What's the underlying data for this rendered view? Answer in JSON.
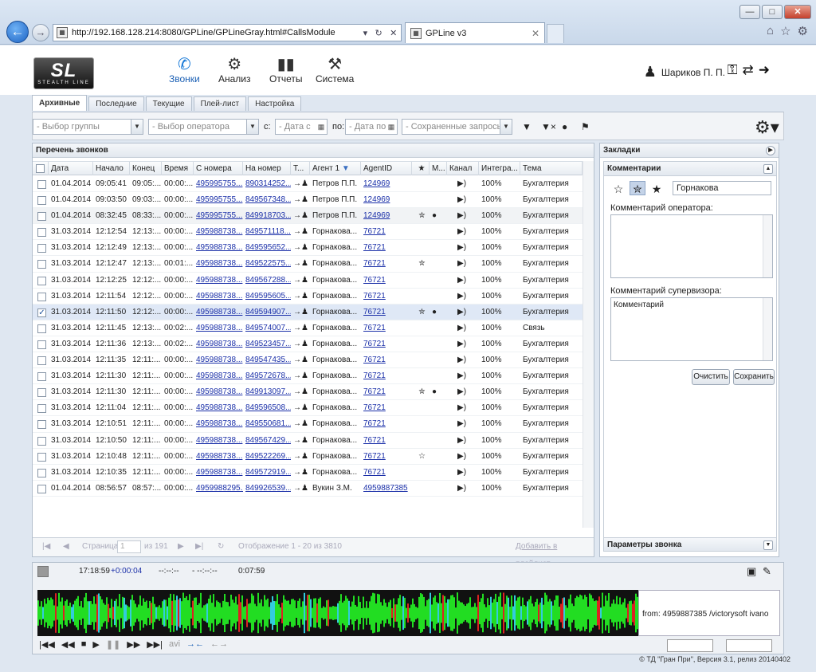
{
  "browser": {
    "url": "http://192.168.128.214:8080/GPLine/GPLineGray.html#CallsModule",
    "tab_title": "GPLine v3",
    "favicon": "page-icon",
    "window_buttons": [
      "minimize",
      "maximize",
      "close"
    ]
  },
  "app": {
    "logo_text": "SL",
    "logo_sub": "STEALTH LINE",
    "menu": [
      {
        "label": "Звонки",
        "icon": "phone-icon",
        "active": true
      },
      {
        "label": "Анализ",
        "icon": "gears-icon",
        "active": false
      },
      {
        "label": "Отчеты",
        "icon": "bar-chart-icon",
        "active": false
      },
      {
        "label": "Система",
        "icon": "tools-icon",
        "active": false
      }
    ],
    "user_name": "Шариков П. П."
  },
  "tabs": [
    "Архивные",
    "Последние",
    "Текущие",
    "Плей-лист",
    "Настройка"
  ],
  "filters": {
    "group": "- Выбор группы",
    "operator": "- Выбор оператора",
    "from_label": "с:",
    "date_from": "- Дата с",
    "to_label": "по:",
    "date_to": "- Дата по",
    "saved": "- Сохраненные запросы"
  },
  "calls": {
    "title": "Перечень звонков",
    "columns": [
      "Дата",
      "Начало",
      "Конец",
      "Время",
      "С номера",
      "На номер",
      "Т...",
      "Агент 1",
      "AgentID",
      "★",
      "М...",
      "Канал",
      "Интегра...",
      "Тема"
    ],
    "rows": [
      {
        "date": "01.04.2014",
        "start": "09:05:41",
        "end": "09:05:...",
        "dur": "00:00:...",
        "from": "495995755...",
        "to": "890314252...",
        "agent": "Петров П.П.",
        "agentid": "124969",
        "star": "",
        "m": "",
        "quality": "100%",
        "topic": "Бухгалтерия",
        "checked": false
      },
      {
        "date": "01.04.2014",
        "start": "09:03:50",
        "end": "09:03:...",
        "dur": "00:00:...",
        "from": "495995755...",
        "to": "849567348...",
        "agent": "Петров П.П.",
        "agentid": "124969",
        "star": "",
        "m": "",
        "quality": "100%",
        "topic": "Бухгалтерия",
        "checked": false
      },
      {
        "date": "01.04.2014",
        "start": "08:32:45",
        "end": "08:33:...",
        "dur": "00:00:...",
        "from": "495995755...",
        "to": "849918703...",
        "agent": "Петров П.П.",
        "agentid": "124969",
        "star": "half",
        "m": "yes",
        "quality": "100%",
        "topic": "Бухгалтерия",
        "checked": false
      },
      {
        "date": "31.03.2014",
        "start": "12:12:54",
        "end": "12:13:...",
        "dur": "00:00:...",
        "from": "495988738...",
        "to": "849571118...",
        "agent": "Горнакова...",
        "agentid": "76721",
        "star": "",
        "m": "",
        "quality": "100%",
        "topic": "Бухгалтерия",
        "checked": false
      },
      {
        "date": "31.03.2014",
        "start": "12:12:49",
        "end": "12:13:...",
        "dur": "00:00:...",
        "from": "495988738...",
        "to": "849595652...",
        "agent": "Горнакова...",
        "agentid": "76721",
        "star": "",
        "m": "",
        "quality": "100%",
        "topic": "Бухгалтерия",
        "checked": false
      },
      {
        "date": "31.03.2014",
        "start": "12:12:47",
        "end": "12:13:...",
        "dur": "00:01:...",
        "from": "495988738...",
        "to": "849522575...",
        "agent": "Горнакова...",
        "agentid": "76721",
        "star": "half",
        "m": "",
        "quality": "100%",
        "topic": "Бухгалтерия",
        "checked": false
      },
      {
        "date": "31.03.2014",
        "start": "12:12:25",
        "end": "12:12:...",
        "dur": "00:00:...",
        "from": "495988738...",
        "to": "849567288...",
        "agent": "Горнакова...",
        "agentid": "76721",
        "star": "",
        "m": "",
        "quality": "100%",
        "topic": "Бухгалтерия",
        "checked": false
      },
      {
        "date": "31.03.2014",
        "start": "12:11:54",
        "end": "12:12:...",
        "dur": "00:00:...",
        "from": "495988738...",
        "to": "849595605...",
        "agent": "Горнакова...",
        "agentid": "76721",
        "star": "",
        "m": "",
        "quality": "100%",
        "topic": "Бухгалтерия",
        "checked": false
      },
      {
        "date": "31.03.2014",
        "start": "12:11:50",
        "end": "12:12:...",
        "dur": "00:00:...",
        "from": "495988738...",
        "to": "849594907...",
        "agent": "Горнакова...",
        "agentid": "76721",
        "star": "half",
        "m": "yes",
        "quality": "100%",
        "topic": "Бухгалтерия",
        "checked": true
      },
      {
        "date": "31.03.2014",
        "start": "12:11:45",
        "end": "12:13:...",
        "dur": "00:02:...",
        "from": "495988738...",
        "to": "849574007...",
        "agent": "Горнакова...",
        "agentid": "76721",
        "star": "",
        "m": "",
        "quality": "100%",
        "topic": "Связь",
        "checked": false
      },
      {
        "date": "31.03.2014",
        "start": "12:11:36",
        "end": "12:13:...",
        "dur": "00:02:...",
        "from": "495988738...",
        "to": "849523457...",
        "agent": "Горнакова...",
        "agentid": "76721",
        "star": "",
        "m": "",
        "quality": "100%",
        "topic": "Бухгалтерия",
        "checked": false
      },
      {
        "date": "31.03.2014",
        "start": "12:11:35",
        "end": "12:11:...",
        "dur": "00:00:...",
        "from": "495988738...",
        "to": "849547435...",
        "agent": "Горнакова...",
        "agentid": "76721",
        "star": "",
        "m": "",
        "quality": "100%",
        "topic": "Бухгалтерия",
        "checked": false
      },
      {
        "date": "31.03.2014",
        "start": "12:11:30",
        "end": "12:11:...",
        "dur": "00:00:...",
        "from": "495988738...",
        "to": "849572678...",
        "agent": "Горнакова...",
        "agentid": "76721",
        "star": "",
        "m": "",
        "quality": "100%",
        "topic": "Бухгалтерия",
        "checked": false
      },
      {
        "date": "31.03.2014",
        "start": "12:11:30",
        "end": "12:11:...",
        "dur": "00:00:...",
        "from": "495988738...",
        "to": "849913097...",
        "agent": "Горнакова...",
        "agentid": "76721",
        "star": "half",
        "m": "yes",
        "quality": "100%",
        "topic": "Бухгалтерия",
        "checked": false
      },
      {
        "date": "31.03.2014",
        "start": "12:11:04",
        "end": "12:11:...",
        "dur": "00:00:...",
        "from": "495988738...",
        "to": "849596508...",
        "agent": "Горнакова...",
        "agentid": "76721",
        "star": "",
        "m": "",
        "quality": "100%",
        "topic": "Бухгалтерия",
        "checked": false
      },
      {
        "date": "31.03.2014",
        "start": "12:10:51",
        "end": "12:11:...",
        "dur": "00:00:...",
        "from": "495988738...",
        "to": "849550681...",
        "agent": "Горнакова...",
        "agentid": "76721",
        "star": "",
        "m": "",
        "quality": "100%",
        "topic": "Бухгалтерия",
        "checked": false
      },
      {
        "date": "31.03.2014",
        "start": "12:10:50",
        "end": "12:11:...",
        "dur": "00:00:...",
        "from": "495988738...",
        "to": "849567429...",
        "agent": "Горнакова...",
        "agentid": "76721",
        "star": "",
        "m": "",
        "quality": "100%",
        "topic": "Бухгалтерия",
        "checked": false
      },
      {
        "date": "31.03.2014",
        "start": "12:10:48",
        "end": "12:11:...",
        "dur": "00:00:...",
        "from": "495988738...",
        "to": "849522269...",
        "agent": "Горнакова...",
        "agentid": "76721",
        "star": "empty",
        "m": "",
        "quality": "100%",
        "topic": "Бухгалтерия",
        "checked": false
      },
      {
        "date": "31.03.2014",
        "start": "12:10:35",
        "end": "12:11:...",
        "dur": "00:00:...",
        "from": "495988738...",
        "to": "849572919...",
        "agent": "Горнакова...",
        "agentid": "76721",
        "star": "",
        "m": "",
        "quality": "100%",
        "topic": "Бухгалтерия",
        "checked": false
      },
      {
        "date": "01.04.2014",
        "start": "08:56:57",
        "end": "08:57:...",
        "dur": "00:00:...",
        "from": "4959988295...",
        "to": "849926539...",
        "agent": "Вукин З.М.",
        "agentid": "4959887385",
        "star": "",
        "m": "",
        "quality": "100%",
        "topic": "Бухгалтерия",
        "checked": false
      }
    ]
  },
  "pager": {
    "page_label": "Страница",
    "page_value": "1",
    "of_label": "из 191",
    "display": "Отображение 1 - 20 из 3810",
    "add_playlist": "Добавить в плейлист"
  },
  "right": {
    "bookmarks": "Закладки",
    "comments": "Комментарии",
    "operator_name": "Горнакова",
    "operator_comment_label": "Комментарий оператора:",
    "supervisor_comment_label": "Комментарий супервизора:",
    "supervisor_comment": "Комментарий",
    "clear_btn": "Очистить",
    "save_btn": "Сохранить",
    "call_params": "Параметры звонка"
  },
  "player": {
    "clock": "17:18:59",
    "offset": "+0:00:04",
    "t1": "--:--:--",
    "t2": "- --:--:--",
    "length": "0:07:59",
    "from_info": "from: 4959887385 /victorysoft ivano",
    "avi": "avi"
  },
  "footer": "© ТД \"Гран При\", Версия 3.1, релиз 20140402",
  "colors": {
    "accent": "#1a7bd8",
    "link": "#1a2fa8",
    "wave_green": "#22dd22",
    "wave_cyan": "#33ccdd",
    "wave_red": "#dd2222"
  }
}
